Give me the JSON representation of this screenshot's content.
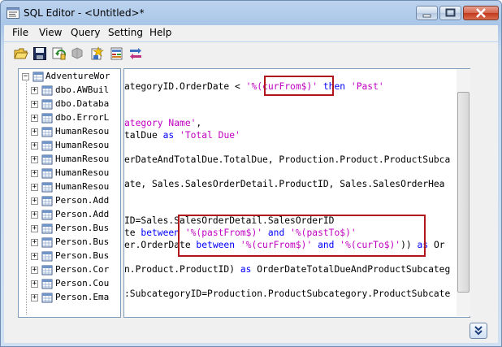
{
  "window": {
    "title": "SQL Editor - <Untitled>*"
  },
  "menu": [
    "File",
    "View",
    "Query",
    "Setting",
    "Help"
  ],
  "toolbar": [
    "open-folder-icon",
    "save-icon",
    "refresh-query-icon",
    "disconnect-icon",
    "run-query-icon",
    "build-query-icon",
    "settings-query-icon"
  ],
  "tree": {
    "root": "AdventureWor",
    "items": [
      "dbo.AWBuil",
      "dbo.Databa",
      "dbo.ErrorL",
      "HumanResou",
      "HumanResou",
      "HumanResou",
      "HumanResou",
      "HumanResou",
      "Person.Add",
      "Person.Add",
      "Person.Bus",
      "Person.Bus",
      "Person.Bus",
      "Person.Cor",
      "Person.Cou",
      "Person.Ema"
    ]
  },
  "editor": {
    "lines": [
      [
        {
          "t": "ategoryID.OrderDate < ",
          "c": "n"
        },
        {
          "t": "'%(curFrom$)'",
          "c": "s"
        },
        {
          "t": " ",
          "c": "n"
        },
        {
          "t": "then",
          "c": "k"
        },
        {
          "t": " ",
          "c": "n"
        },
        {
          "t": "'Past'",
          "c": "s"
        }
      ],
      [],
      [],
      [
        {
          "t": "ategory Name'",
          "c": "s"
        },
        {
          "t": ",",
          "c": "n"
        }
      ],
      [
        {
          "t": "talDue ",
          "c": "n"
        },
        {
          "t": "as",
          "c": "k"
        },
        {
          "t": " ",
          "c": "n"
        },
        {
          "t": "'Total Due'",
          "c": "s"
        }
      ],
      [],
      [
        {
          "t": "erDateAndTotalDue.TotalDue, Production.Product.ProductSubca",
          "c": "n"
        }
      ],
      [],
      [
        {
          "t": "ate, Sales.SalesOrderDetail.ProductID, Sales.SalesOrderHea",
          "c": "n"
        }
      ],
      [],
      [],
      [
        {
          "t": "ID=Sales.SalesOrderDetail.SalesOrderID",
          "c": "n"
        }
      ],
      [
        {
          "t": "te ",
          "c": "n"
        },
        {
          "t": "between",
          "c": "k"
        },
        {
          "t": " ",
          "c": "n"
        },
        {
          "t": "'%(pastFrom$)'",
          "c": "s"
        },
        {
          "t": " ",
          "c": "n"
        },
        {
          "t": "and",
          "c": "k"
        },
        {
          "t": " ",
          "c": "n"
        },
        {
          "t": "'%(pastTo$)'",
          "c": "s"
        }
      ],
      [
        {
          "t": "er.OrderDate ",
          "c": "n"
        },
        {
          "t": "between",
          "c": "k"
        },
        {
          "t": " ",
          "c": "n"
        },
        {
          "t": "'%(curFrom$)'",
          "c": "s"
        },
        {
          "t": " ",
          "c": "n"
        },
        {
          "t": "and",
          "c": "k"
        },
        {
          "t": " ",
          "c": "n"
        },
        {
          "t": "'%(curTo$)'",
          "c": "s"
        },
        {
          "t": ")) ",
          "c": "n"
        },
        {
          "t": "as",
          "c": "k"
        },
        {
          "t": " Or",
          "c": "n"
        }
      ],
      [],
      [
        {
          "t": "n.Product.ProductID) ",
          "c": "n"
        },
        {
          "t": "as",
          "c": "k"
        },
        {
          "t": " OrderDateTotalDueAndProductSubcateg",
          "c": "n"
        }
      ],
      [],
      [
        {
          "t": ":SubcategoryID=Production.ProductSubcategory.ProductSubcate",
          "c": "n"
        }
      ]
    ]
  }
}
